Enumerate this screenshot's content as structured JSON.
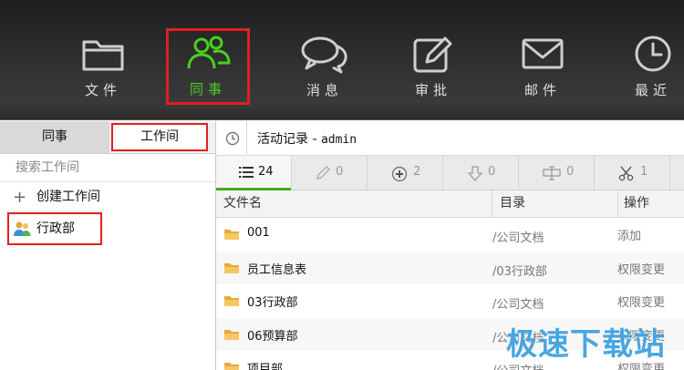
{
  "toolbar": {
    "items": [
      {
        "label": "文件",
        "icon": "folder-icon"
      },
      {
        "label": "同事",
        "icon": "colleagues-icon",
        "active": true
      },
      {
        "label": "消息",
        "icon": "chat-bubbles-icon"
      },
      {
        "label": "审批",
        "icon": "edit-icon"
      },
      {
        "label": "邮件",
        "icon": "envelope-icon"
      },
      {
        "label": "最近",
        "icon": "clock-icon"
      }
    ]
  },
  "left_panel": {
    "tabs": [
      {
        "label": "同事"
      },
      {
        "label": "工作间",
        "active": true
      }
    ],
    "search_placeholder": "搜索工作间",
    "create_label": "创建工作间",
    "department_label": "行政部"
  },
  "right_panel": {
    "title_prefix": "活动记录 - ",
    "title_user": "admin",
    "filter_tabs": [
      {
        "icon": "list-icon",
        "count": "24",
        "active": true
      },
      {
        "icon": "pencil-icon",
        "count": "0"
      },
      {
        "icon": "plus-circle-icon",
        "count": "2"
      },
      {
        "icon": "download-icon",
        "count": "0"
      },
      {
        "icon": "move-icon",
        "count": "0"
      },
      {
        "icon": "scissors-icon",
        "count": "1"
      }
    ],
    "columns": {
      "name": "文件名",
      "dir": "目录",
      "op": "操作"
    },
    "rows": [
      {
        "name": "001",
        "dir": "/公司文档",
        "op": "添加"
      },
      {
        "name": "员工信息表",
        "dir": "/03行政部",
        "op": "权限变更"
      },
      {
        "name": "03行政部",
        "dir": "/公司文档",
        "op": "权限变更"
      },
      {
        "name": "06预算部",
        "dir": "/公司文档",
        "op": "权限变更"
      },
      {
        "name": "项目部",
        "dir": "/公司文档",
        "op": "权限变更"
      }
    ]
  },
  "watermark": "极速下载站",
  "colors": {
    "accent_green": "#47d11e",
    "highlight_red": "#e02020",
    "active_underline": "#3fae1e"
  }
}
